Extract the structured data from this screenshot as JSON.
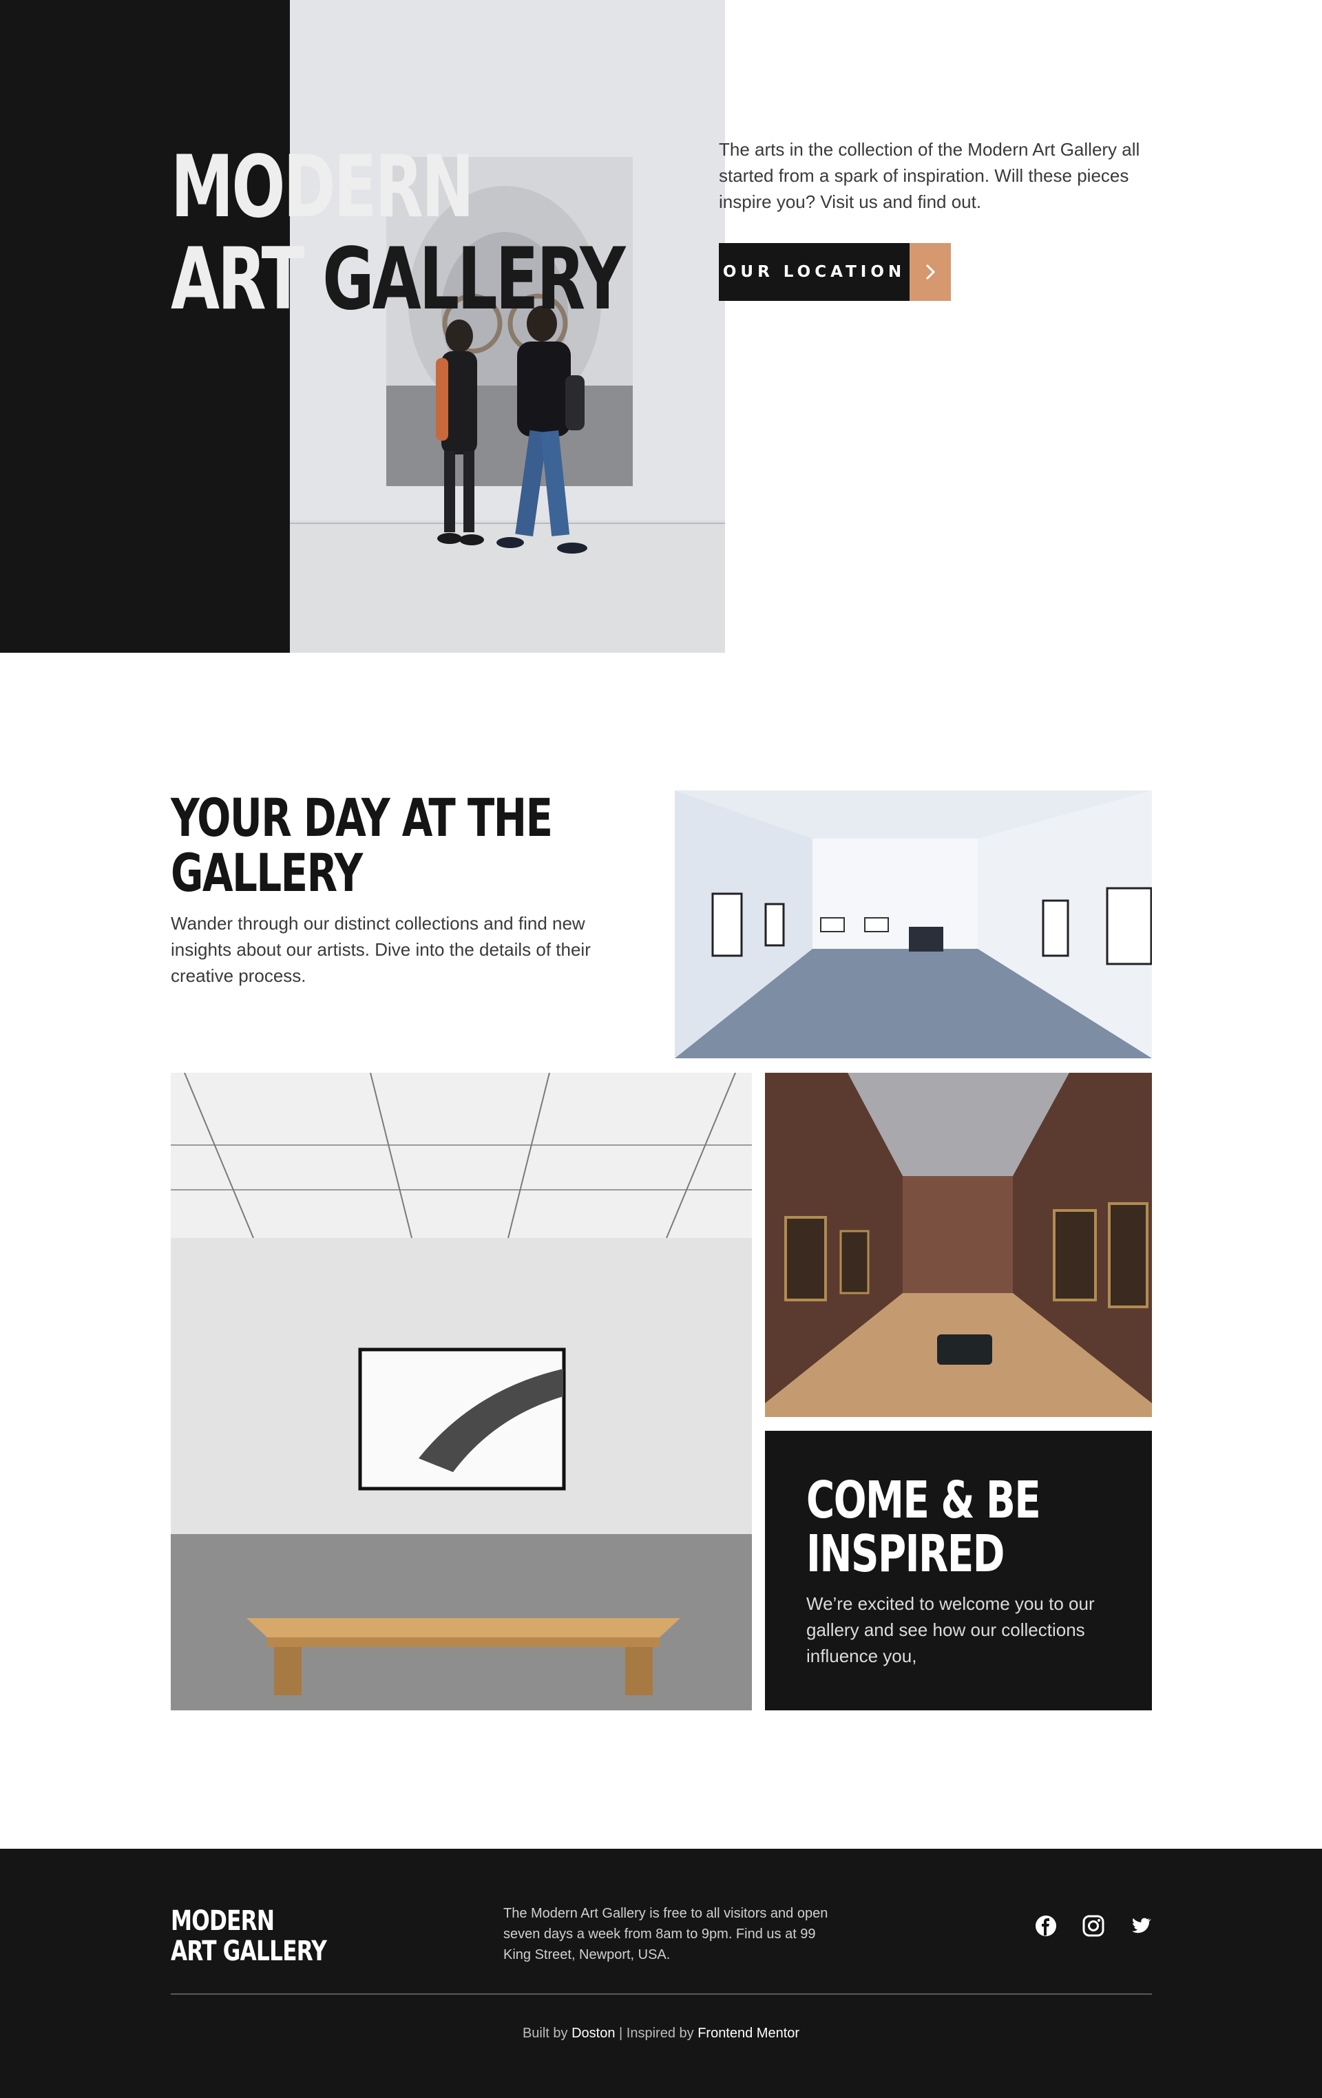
{
  "hero": {
    "title_line1": "MODERN",
    "title_line2_a": "ART",
    "title_line2_b": " GALLERY",
    "intro": "The arts in the collection of the Modern Art Gallery all started from a spark of inspiration. Will these pieces inspire you? Visit us and find out.",
    "cta_label": "OUR LOCATION",
    "cta_icon": "chevron-right-icon"
  },
  "gallery_section": {
    "title_line1": "YOUR DAY AT THE",
    "title_line2": "GALLERY",
    "text": "Wander through our distinct collections and find new insights about our artists. Dive into the details of their creative process."
  },
  "inspire": {
    "title_line1": "COME & BE",
    "title_line2": "INSPIRED",
    "text": "We’re excited to welcome you to our gallery and see how our collections influence you,"
  },
  "footer": {
    "logo_line1": "MODERN",
    "logo_line2": "ART GALLERY",
    "info": "The Modern Art Gallery is free to all visitors and open seven days a week from 8am to 9pm. Find us at 99 King Street, Newport, USA.",
    "social_icons": [
      "facebook-icon",
      "instagram-icon",
      "twitter-icon"
    ],
    "credits_prefix": "Built by ",
    "credits_author": "Doston",
    "credits_middle": " | Inspired by ",
    "credits_source": "Frontend Mentor"
  },
  "colors": {
    "dark": "#151515",
    "accent": "#d5986f",
    "white": "#ffffff"
  }
}
